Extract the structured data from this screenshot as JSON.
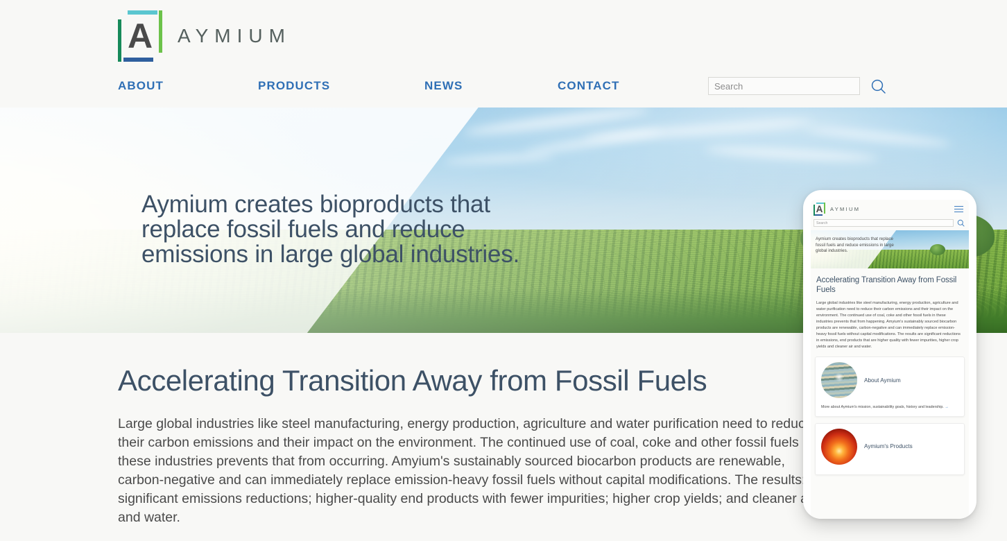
{
  "brand": {
    "letter": "A",
    "wordmark": "AYMIUM"
  },
  "nav": {
    "items": [
      {
        "label": "ABOUT"
      },
      {
        "label": "PRODUCTS"
      },
      {
        "label": "NEWS"
      },
      {
        "label": "CONTACT"
      }
    ]
  },
  "search": {
    "placeholder": "Search",
    "value": ""
  },
  "hero": {
    "headline": "Aymium creates bioproducts that replace fossil fuels and reduce emissions in large global industries."
  },
  "main": {
    "title": "Accelerating Transition Away from Fossil Fuels",
    "body": "Large global industries like steel manufacturing, energy production, agriculture and water purification need to reduce their carbon emissions and their impact on the environment. The continued use of coal, coke and other fossil fuels in these industries prevents that from occurring. Amyium's sustainably sourced biocarbon products are renewable, carbon-negative and can immediately replace emission-heavy fossil fuels without capital modifications. The results: significant emissions reductions; higher-quality end products with fewer impurities; higher crop yields; and cleaner air and water."
  },
  "mobile": {
    "brand": {
      "letter": "A",
      "wordmark": "AYMIUM"
    },
    "search": {
      "placeholder": "Search",
      "value": ""
    },
    "hero": {
      "headline": "Aymium creates bioproducts that replace fossil fuels and reduce emissions in large global industries."
    },
    "title": "Accelerating Transition Away from Fossil Fuels",
    "body": "Large global industries like steel manufacturing, energy production, agriculture and water purification need to reduce their carbon emissions and their impact on the environment. The continued use of coal, coke and other fossil fuels in these industries prevents that from happening. Amyium's sustainably sourced biocarbon products are renewable, carbon-negative and can immediately replace emission-heavy fossil fuels without capital modifications. The results are significant reductions in emissions, end products that are higher quality with fewer impurities, higher crop yields and cleaner air and water.",
    "cards": [
      {
        "title": "About Aymium",
        "description": "More about Aymium's mission, sustainability goals, history and leadership.",
        "arrow": "→"
      },
      {
        "title": "Aymium's Products"
      }
    ]
  },
  "colors": {
    "nav_link": "#2f6fb5",
    "heading": "#3d5166",
    "body_text": "#4a4a4a",
    "page_background": "#f8f8f6",
    "logo_top_bar": "#5bc6d0",
    "logo_right_bar": "#6cc24a",
    "logo_bottom_bar": "#2f5f9e",
    "logo_left_bar": "#178a5a",
    "logo_letter": "#4a4a4a"
  }
}
